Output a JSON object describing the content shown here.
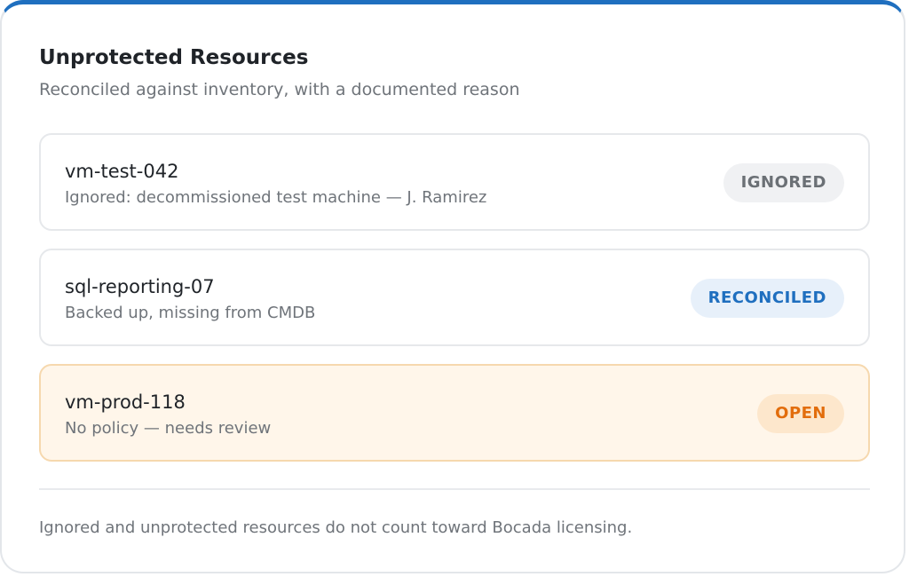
{
  "panel": {
    "title": "Unprotected Resources",
    "subtitle": "Reconciled against inventory, with a documented reason"
  },
  "resources": [
    {
      "name": "vm-test-042",
      "note": "Ignored: decommissioned test machine — J. Ramirez",
      "status": "IGNORED",
      "status_color": "#6b7075"
    },
    {
      "name": "sql-reporting-07",
      "note": "Backed up, missing from CMDB",
      "status": "RECONCILED",
      "status_color": "#1f6fbf"
    },
    {
      "name": "vm-prod-118",
      "note": "No policy — needs review",
      "status": "OPEN",
      "status_color": "#e26d0c"
    }
  ],
  "footer": {
    "note": "Ignored and unprotected resources do not count toward Bocada licensing."
  },
  "colors": {
    "accent": "#1f6fbf",
    "open_highlight": "#fff6ea"
  }
}
